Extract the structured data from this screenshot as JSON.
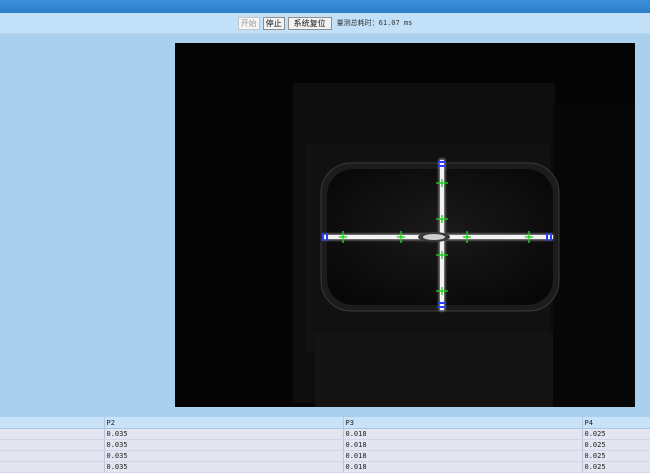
{
  "toolbar": {
    "start_label": "开始",
    "stop_label": "停止",
    "reset_label": "系统复位",
    "timing_text": "量测总耗时：61.07 ms"
  },
  "table": {
    "headers": [
      "",
      "P2",
      "P3",
      "P4"
    ],
    "rows": [
      [
        "",
        "0.035",
        "0.018",
        "0.025"
      ],
      [
        "",
        "0.035",
        "0.018",
        "0.025"
      ],
      [
        "",
        "0.035",
        "0.018",
        "0.025"
      ],
      [
        "",
        "0.035",
        "0.018",
        "0.025"
      ]
    ]
  },
  "colors": {
    "page_bg": "#a9d0ef",
    "title_bar": "#2f7fcb",
    "marker_green": "#1fd21f",
    "marker_blue": "#2a3cff"
  }
}
